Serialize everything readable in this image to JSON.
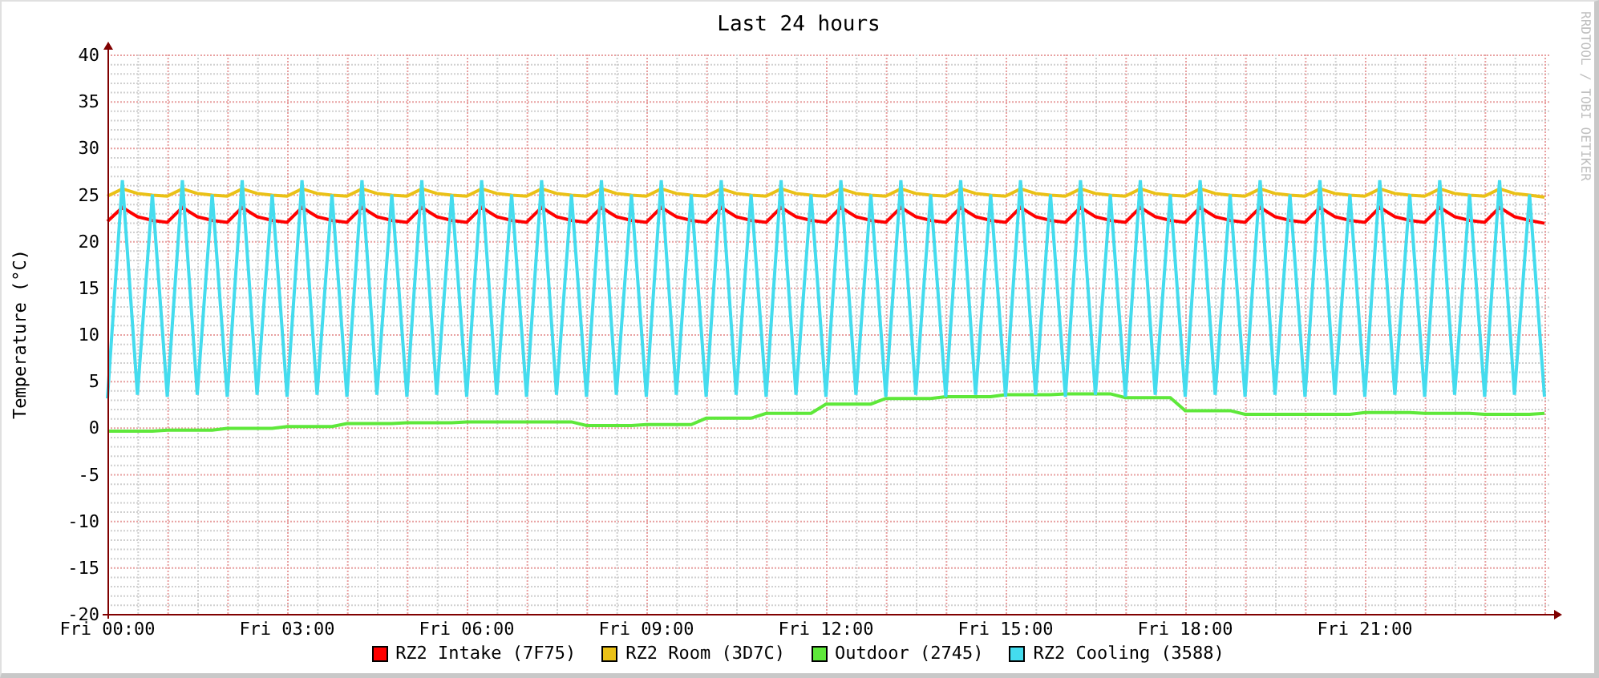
{
  "graph": {
    "side_label": "RRDTOOL / TOBI OETIKER",
    "chart_data": {
      "type": "line",
      "title": "Last 24 hours",
      "ylabel": "Temperature (°C)",
      "ylim": [
        -20,
        40
      ],
      "grid": true,
      "legend": "bottom",
      "yticks": [
        -20,
        -15,
        -10,
        -5,
        0,
        5,
        10,
        15,
        20,
        25,
        30,
        35,
        40
      ],
      "categories": [
        "Fri 00:00",
        null,
        null,
        null,
        null,
        null,
        null,
        null,
        null,
        null,
        null,
        null,
        "Fri 03:00",
        null,
        null,
        null,
        null,
        null,
        null,
        null,
        null,
        null,
        null,
        null,
        "Fri 06:00",
        null,
        null,
        null,
        null,
        null,
        null,
        null,
        null,
        null,
        null,
        null,
        "Fri 09:00",
        null,
        null,
        null,
        null,
        null,
        null,
        null,
        null,
        null,
        null,
        null,
        "Fri 12:00",
        null,
        null,
        null,
        null,
        null,
        null,
        null,
        null,
        null,
        null,
        null,
        "Fri 15:00",
        null,
        null,
        null,
        null,
        null,
        null,
        null,
        null,
        null,
        null,
        null,
        "Fri 18:00",
        null,
        null,
        null,
        null,
        null,
        null,
        null,
        null,
        null,
        null,
        null,
        "Fri 21:00",
        null,
        null,
        null,
        null,
        null,
        null,
        null,
        null,
        null,
        null,
        null,
        null
      ],
      "series": [
        {
          "name": "RZ2 Intake (7F75)",
          "color": "#ff0000",
          "values": [
            22.1,
            23.6,
            22.6,
            22.2,
            22.0,
            23.6,
            22.6,
            22.2,
            22.0,
            23.6,
            22.6,
            22.2,
            22.0,
            23.6,
            22.6,
            22.2,
            22.0,
            23.6,
            22.6,
            22.2,
            22.0,
            23.6,
            22.6,
            22.2,
            22.0,
            23.6,
            22.6,
            22.2,
            22.0,
            23.6,
            22.6,
            22.2,
            22.0,
            23.6,
            22.6,
            22.2,
            22.0,
            23.6,
            22.6,
            22.2,
            22.0,
            23.6,
            22.6,
            22.2,
            22.0,
            23.6,
            22.6,
            22.2,
            22.0,
            23.6,
            22.6,
            22.2,
            22.0,
            23.6,
            22.6,
            22.2,
            22.0,
            23.6,
            22.6,
            22.2,
            22.0,
            23.6,
            22.6,
            22.2,
            22.0,
            23.6,
            22.6,
            22.2,
            22.0,
            23.6,
            22.6,
            22.2,
            22.0,
            23.6,
            22.6,
            22.2,
            22.0,
            23.6,
            22.6,
            22.2,
            22.0,
            23.6,
            22.6,
            22.2,
            22.0,
            23.6,
            22.6,
            22.2,
            22.0,
            23.6,
            22.6,
            22.2,
            22.0,
            23.6,
            22.6,
            22.2,
            21.9
          ]
        },
        {
          "name": "RZ2 Room (3D7C)",
          "color": "#eac117",
          "values": [
            24.8,
            25.6,
            25.1,
            24.9,
            24.8,
            25.6,
            25.1,
            24.9,
            24.8,
            25.6,
            25.1,
            24.9,
            24.8,
            25.6,
            25.1,
            24.9,
            24.8,
            25.6,
            25.1,
            24.9,
            24.8,
            25.6,
            25.1,
            24.9,
            24.8,
            25.6,
            25.1,
            24.9,
            24.8,
            25.6,
            25.1,
            24.9,
            24.8,
            25.6,
            25.1,
            24.9,
            24.8,
            25.6,
            25.1,
            24.9,
            24.8,
            25.6,
            25.1,
            24.9,
            24.8,
            25.6,
            25.1,
            24.9,
            24.8,
            25.6,
            25.1,
            24.9,
            24.8,
            25.6,
            25.1,
            24.9,
            24.8,
            25.6,
            25.1,
            24.9,
            24.8,
            25.6,
            25.1,
            24.9,
            24.8,
            25.6,
            25.1,
            24.9,
            24.8,
            25.6,
            25.1,
            24.9,
            24.8,
            25.6,
            25.1,
            24.9,
            24.8,
            25.6,
            25.1,
            24.9,
            24.8,
            25.6,
            25.1,
            24.9,
            24.8,
            25.6,
            25.1,
            24.9,
            24.8,
            25.6,
            25.1,
            24.9,
            24.8,
            25.6,
            25.1,
            24.9,
            24.7
          ]
        },
        {
          "name": "Outdoor (2745)",
          "color": "#5ee83a",
          "values": [
            -0.4,
            -0.4,
            -0.4,
            -0.4,
            -0.3,
            -0.3,
            -0.3,
            -0.3,
            -0.1,
            -0.1,
            -0.1,
            -0.1,
            0.1,
            0.1,
            0.1,
            0.1,
            0.4,
            0.4,
            0.4,
            0.4,
            0.5,
            0.5,
            0.5,
            0.5,
            0.6,
            0.6,
            0.6,
            0.6,
            0.6,
            0.6,
            0.6,
            0.6,
            0.2,
            0.2,
            0.2,
            0.2,
            0.3,
            0.3,
            0.3,
            0.3,
            1.0,
            1.0,
            1.0,
            1.0,
            1.5,
            1.5,
            1.5,
            1.5,
            2.5,
            2.5,
            2.5,
            2.5,
            3.1,
            3.1,
            3.1,
            3.1,
            3.3,
            3.3,
            3.3,
            3.3,
            3.5,
            3.5,
            3.5,
            3.5,
            3.6,
            3.6,
            3.6,
            3.6,
            3.2,
            3.2,
            3.2,
            3.2,
            1.8,
            1.8,
            1.8,
            1.8,
            1.4,
            1.4,
            1.4,
            1.4,
            1.4,
            1.4,
            1.4,
            1.4,
            1.6,
            1.6,
            1.6,
            1.6,
            1.5,
            1.5,
            1.5,
            1.5,
            1.4,
            1.4,
            1.4,
            1.4,
            1.5
          ]
        },
        {
          "name": "RZ2 Cooling (3588)",
          "color": "#44dcee",
          "values": [
            3.1,
            26.5,
            3.5,
            25.0,
            3.3,
            26.5,
            3.5,
            25.0,
            3.3,
            26.5,
            3.5,
            25.0,
            3.3,
            26.5,
            3.5,
            25.0,
            3.3,
            26.5,
            3.5,
            25.0,
            3.3,
            26.5,
            3.5,
            25.0,
            3.3,
            26.5,
            3.5,
            25.0,
            3.3,
            26.5,
            3.5,
            25.0,
            3.3,
            26.5,
            3.5,
            25.0,
            3.3,
            26.5,
            3.5,
            25.0,
            3.3,
            26.5,
            3.5,
            25.0,
            3.3,
            26.5,
            3.5,
            25.0,
            3.3,
            26.5,
            3.5,
            25.0,
            3.3,
            26.5,
            3.5,
            25.0,
            3.3,
            26.5,
            3.5,
            25.0,
            3.3,
            26.5,
            3.5,
            25.0,
            3.3,
            26.5,
            3.5,
            25.0,
            3.3,
            26.5,
            3.5,
            25.0,
            3.3,
            26.5,
            3.5,
            25.0,
            3.3,
            26.5,
            3.5,
            25.0,
            3.3,
            26.5,
            3.5,
            25.0,
            3.3,
            26.5,
            3.5,
            25.0,
            3.3,
            26.5,
            3.5,
            25.0,
            3.3,
            26.5,
            3.5,
            25.0,
            3.3
          ]
        }
      ]
    }
  }
}
